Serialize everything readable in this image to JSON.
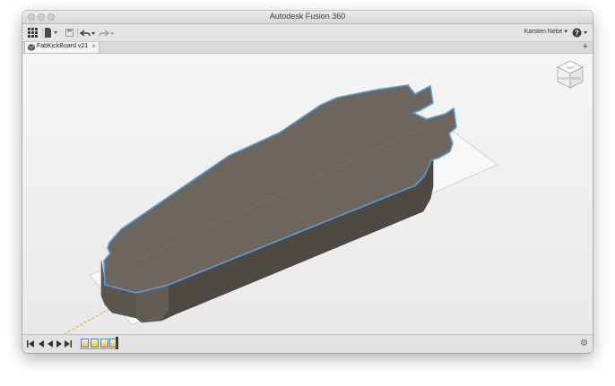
{
  "window": {
    "title": "Autodesk Fusion 360"
  },
  "toolbar": {
    "user": "Karsten Nebe ▾"
  },
  "tabs": [
    {
      "label": "FabKickBoard v21"
    }
  ],
  "viewcube": {
    "top_label": "TOP",
    "front_label": "FRONT",
    "right_label": "RIGHT"
  },
  "colors": {
    "model_top": "#6c665f",
    "model_side": "#4f4a44",
    "selection_edge": "#5b9bd6",
    "origin_axis": "#e09b3d"
  },
  "icons": {
    "data_panel": "grid-icon",
    "file_menu": "file-icon",
    "save": "save-icon",
    "undo": "undo-icon",
    "redo": "redo-icon",
    "help": "help-icon",
    "settings": "gear-icon"
  }
}
